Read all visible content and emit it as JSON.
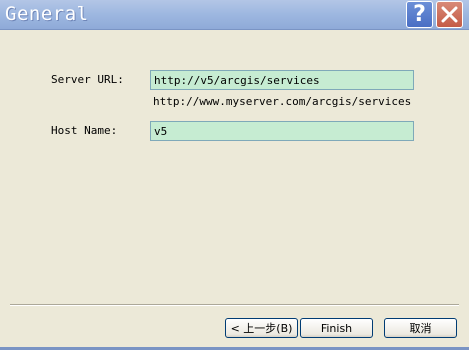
{
  "window": {
    "title": "General",
    "help_icon": "question-mark",
    "close_icon": "x-mark"
  },
  "form": {
    "server_url": {
      "label": "Server URL:",
      "value": "http://v5/arcgis/services",
      "hint": "http://www.myserver.com/arcgis/services"
    },
    "host_name": {
      "label": "Host Name:",
      "value": "v5"
    }
  },
  "buttons": {
    "back_label": "< 上一步(B)",
    "finish_label": "Finish",
    "cancel_label": "取消"
  },
  "colors": {
    "titlebar": "#9db7e0",
    "dialog_background": "#ece9d8",
    "field_background": "#c6ecd2",
    "close_button": "#c45b46"
  }
}
